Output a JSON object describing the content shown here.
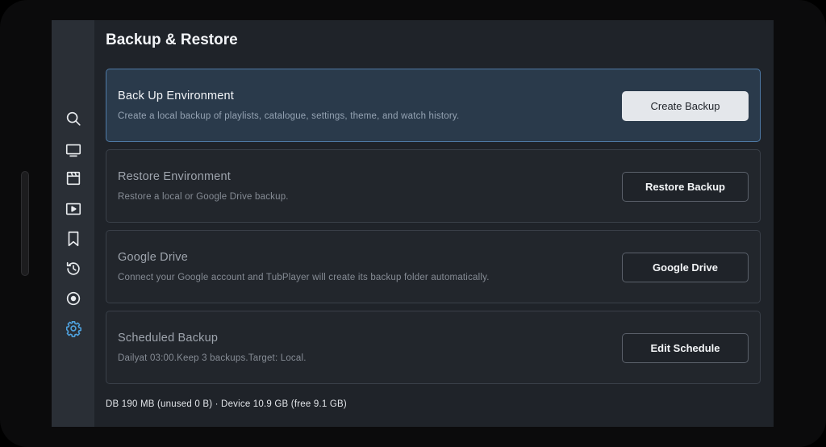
{
  "page": {
    "title": "Backup & Restore"
  },
  "nav": [
    {
      "icon": "search-icon",
      "label": ""
    },
    {
      "icon": "tv-icon",
      "label": ""
    },
    {
      "icon": "clapperboard-icon",
      "label": ""
    },
    {
      "icon": "video-playlist-icon",
      "label": ""
    },
    {
      "icon": "bookmark-icon",
      "label": ""
    },
    {
      "icon": "history-icon",
      "label": ""
    },
    {
      "icon": "record-icon",
      "label": ""
    },
    {
      "icon": "settings-gear-icon",
      "label": "",
      "active": true
    }
  ],
  "cards": [
    {
      "title": "Back Up Environment",
      "description": "Create a local backup of playlists, catalogue, settings, theme, and watch history.",
      "button": "Create Backup"
    },
    {
      "title": "Restore Environment",
      "description": "Restore a local or Google Drive backup.",
      "button": "Restore Backup"
    },
    {
      "title": "Google Drive",
      "description": "Connect your Google account and TubPlayer will create its backup folder automatically.",
      "button": "Google Drive"
    },
    {
      "title": "Scheduled Backup",
      "description": "Dailyat 03:00.Keep 3 backups.Target: Local.",
      "button": "Edit Schedule"
    }
  ],
  "footer": {
    "storage": "DB 190 MB (unused 0 B) · Device 10.9 GB (free 9.1 GB)"
  },
  "colors": {
    "accent": "#4fa3e0",
    "icon": "#e9ecef",
    "background": "#1f2329",
    "rail": "#2a2f36"
  }
}
